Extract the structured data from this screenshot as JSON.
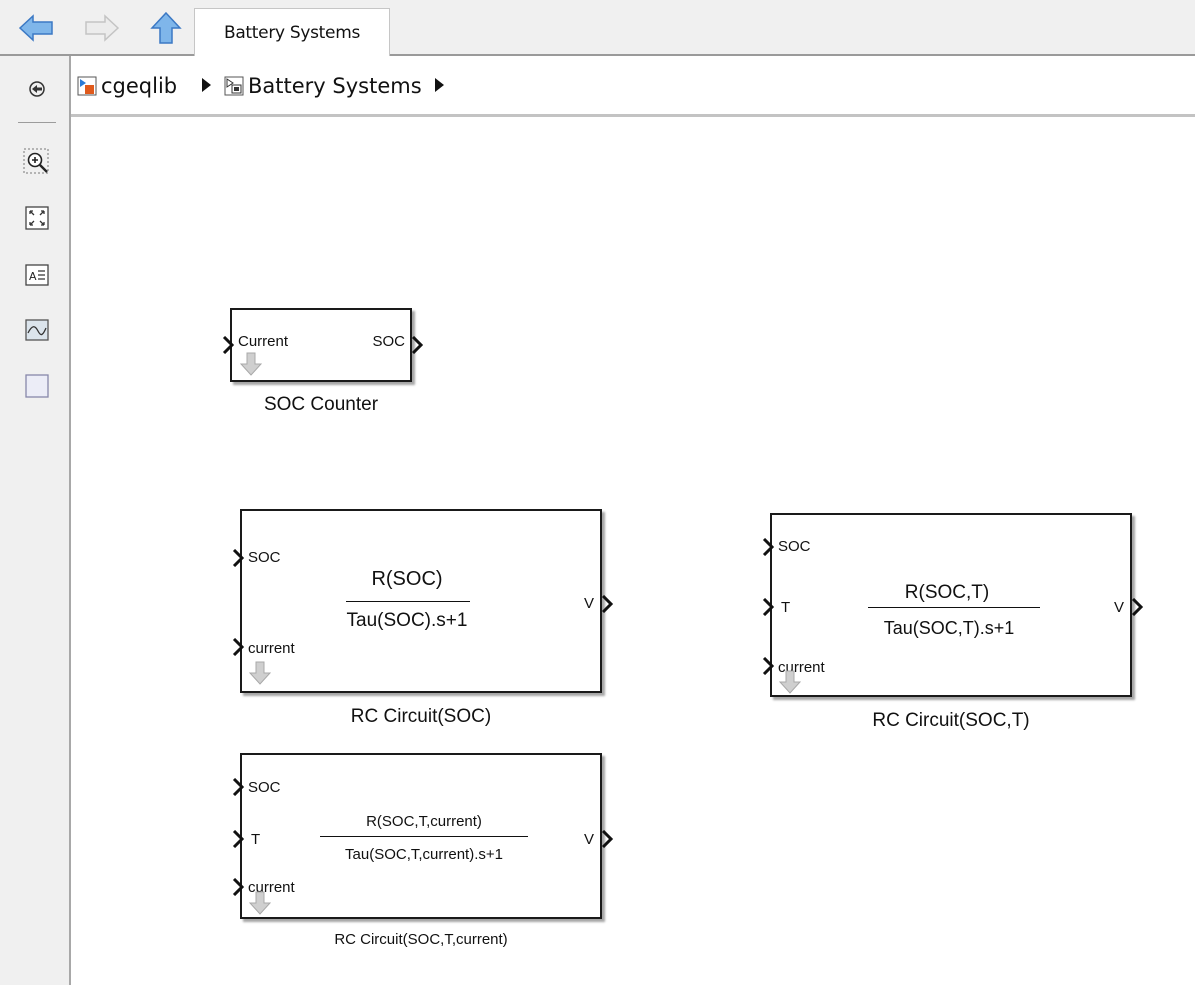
{
  "window": {
    "active_tab_label": "Battery Systems",
    "nav": {
      "back_icon": "back-arrow-icon",
      "forward_icon": "forward-arrow-icon",
      "up_icon": "up-arrow-icon"
    }
  },
  "breadcrumb": {
    "items": [
      {
        "label": "cgeqlib",
        "icon": "library-icon"
      },
      {
        "label": "Battery Systems",
        "icon": "subsystem-icon"
      }
    ]
  },
  "toolstrip": {
    "tools": [
      {
        "name": "hide-show-browser",
        "icon": "circle-arrow-icon"
      },
      {
        "name": "zoom",
        "icon": "zoom-in-icon"
      },
      {
        "name": "fit-to-view",
        "icon": "fit-view-icon"
      },
      {
        "name": "annotation",
        "icon": "text-annotation-icon"
      },
      {
        "name": "image",
        "icon": "image-icon"
      },
      {
        "name": "area",
        "icon": "area-icon"
      }
    ]
  },
  "blocks": {
    "soc_counter": {
      "name": "SOC Counter",
      "inputs": [
        "Current"
      ],
      "outputs": [
        "SOC"
      ]
    },
    "rc_soc": {
      "name": "RC Circuit(SOC)",
      "inputs": [
        "SOC",
        "current"
      ],
      "outputs": [
        "V"
      ],
      "numerator": "R(SOC)",
      "denominator": "Tau(SOC).s+1"
    },
    "rc_soc_t": {
      "name": "RC Circuit(SOC,T)",
      "inputs": [
        "SOC",
        "T",
        "current"
      ],
      "outputs": [
        "V"
      ],
      "numerator": "R(SOC,T)",
      "denominator": "Tau(SOC,T).s+1"
    },
    "rc_soc_t_current": {
      "name": "RC Circuit(SOC,T,current)",
      "inputs": [
        "SOC",
        "T",
        "current"
      ],
      "outputs": [
        "V"
      ],
      "numerator": "R(SOC,T,current)",
      "denominator": "Tau(SOC,T,current).s+1"
    }
  },
  "colors": {
    "chrome_bg": "#f0f0f0",
    "nav_arrow_blue": "#4a90d9",
    "nav_arrow_disabled": "#d0d0d0",
    "block_border": "#1a1a1a",
    "reference_arrow_gray": "#b0b0b0"
  }
}
